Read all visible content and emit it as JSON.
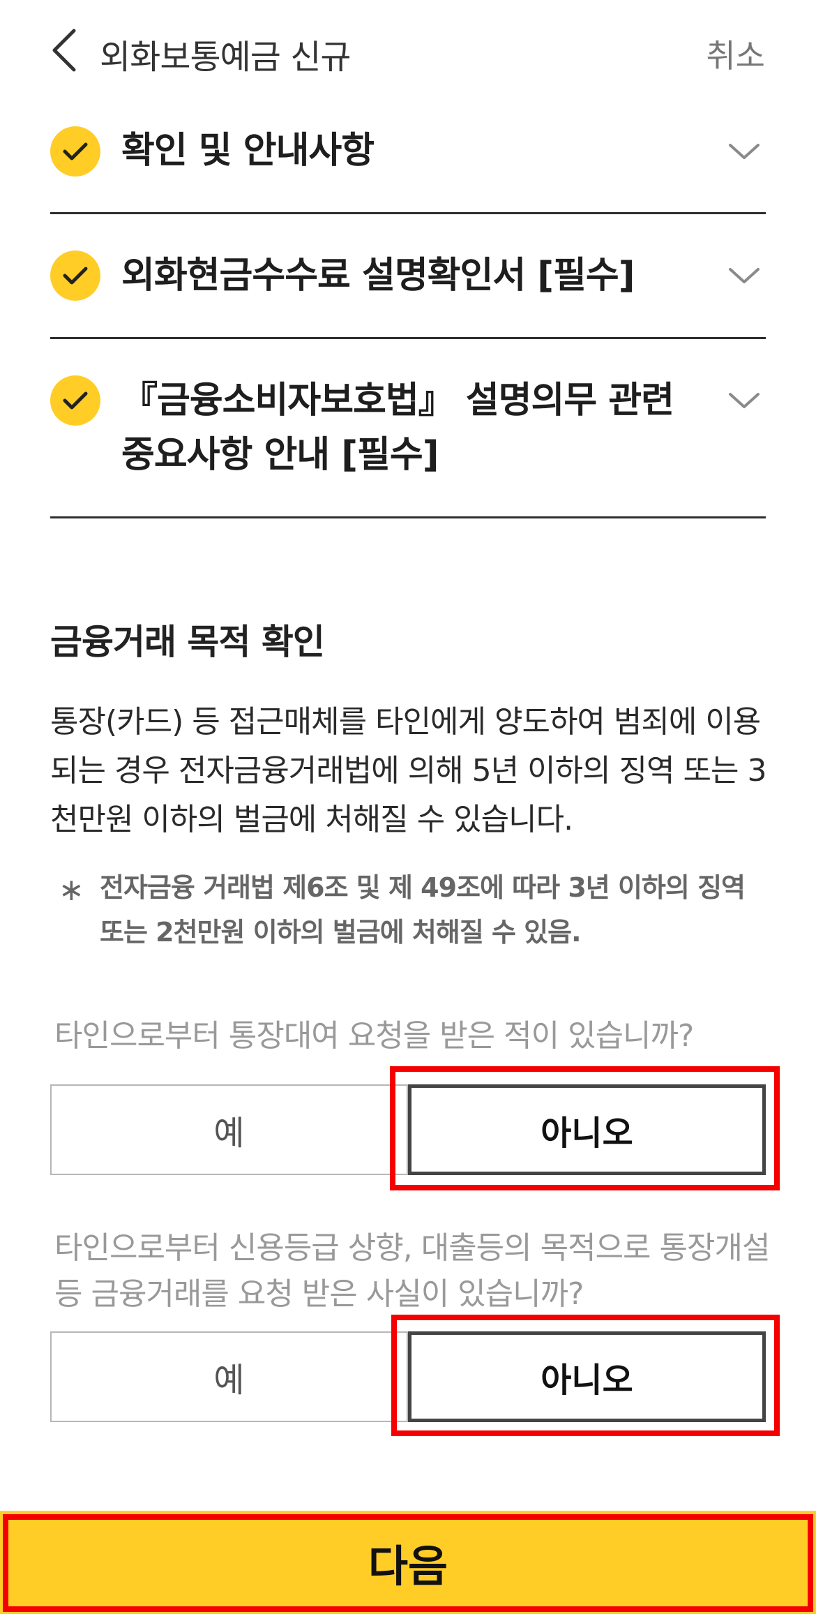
{
  "header": {
    "title": "외화보통예금 신규",
    "cancel_label": "취소"
  },
  "accordion": [
    {
      "title": "확인 및 안내사항"
    },
    {
      "title": "외화현금수수료 설명확인서 [필수]"
    },
    {
      "title": "『금융소비자보호법』 설명의무 관련 중요사항 안내 [필수]"
    }
  ],
  "section": {
    "title": "금융거래 목적 확인",
    "body": "통장(카드) 등 접근매체를 타인에게 양도하여 범죄에 이용되는 경우 전자금융거래법에 의해 5년 이하의 징역 또는 3천만원 이하의 벌금에 처해질 수 있습니다.",
    "note_mark": "∗",
    "note": "전자금융 거래법 제6조 및 제 49조에 따라 3년 이하의 징역 또는 2천만원 이하의 벌금에 처해질 수 있음."
  },
  "questions": [
    {
      "text": "타인으로부터 통장대여 요청을 받은 적이 있습니까?",
      "yes_label": "예",
      "no_label": "아니오",
      "selected": "아니오"
    },
    {
      "text": "타인으로부터 신용등급 상향, 대출등의 목적으로 통장개설 등 금융거래를 요청 받은 사실이 있습니까?",
      "yes_label": "예",
      "no_label": "아니오",
      "selected": "아니오"
    }
  ],
  "footer": {
    "next_label": "다음"
  },
  "colors": {
    "accent": "#ffcd26",
    "highlight": "#f40000"
  }
}
